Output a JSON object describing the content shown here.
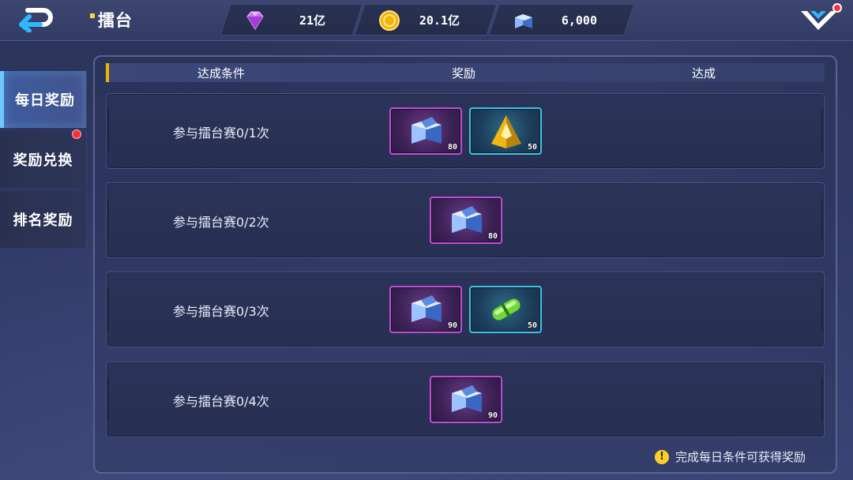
{
  "header": {
    "title": "擂台",
    "resources": [
      {
        "name": "diamond-icon",
        "value": "21亿"
      },
      {
        "name": "gold-coin-icon",
        "value": "20.1亿"
      },
      {
        "name": "arena-box-icon",
        "value": "6,000"
      }
    ]
  },
  "tabs": [
    {
      "label": "每日奖励",
      "active": true,
      "badge": false
    },
    {
      "label": "奖励兑换",
      "active": false,
      "badge": true
    },
    {
      "label": "排名奖励",
      "active": false,
      "badge": false
    }
  ],
  "table": {
    "columns": [
      "达成条件",
      "奖励",
      "达成"
    ],
    "rows": [
      {
        "condition": "参与擂台赛0/1次",
        "rewards": [
          {
            "icon": "arena-box-icon",
            "count": "80",
            "rarity": "purple"
          },
          {
            "icon": "gold-pyramid-icon",
            "count": "50",
            "rarity": "cyan"
          }
        ]
      },
      {
        "condition": "参与擂台赛0/2次",
        "rewards": [
          {
            "icon": "arena-box-icon",
            "count": "80",
            "rarity": "purple"
          }
        ]
      },
      {
        "condition": "参与擂台赛0/3次",
        "rewards": [
          {
            "icon": "arena-box-icon",
            "count": "90",
            "rarity": "purple"
          },
          {
            "icon": "green-capsule-icon",
            "count": "50",
            "rarity": "cyan"
          }
        ]
      },
      {
        "condition": "参与擂台赛0/4次",
        "rewards": [
          {
            "icon": "arena-box-icon",
            "count": "90",
            "rarity": "purple"
          }
        ]
      }
    ]
  },
  "footer": {
    "hint": "完成每日条件可获得奖励"
  },
  "colors": {
    "accent": "#6fc6ff",
    "rarity_purple": "#c24cd6",
    "rarity_cyan": "#39c6e6",
    "badge": "#ff2f3a"
  }
}
